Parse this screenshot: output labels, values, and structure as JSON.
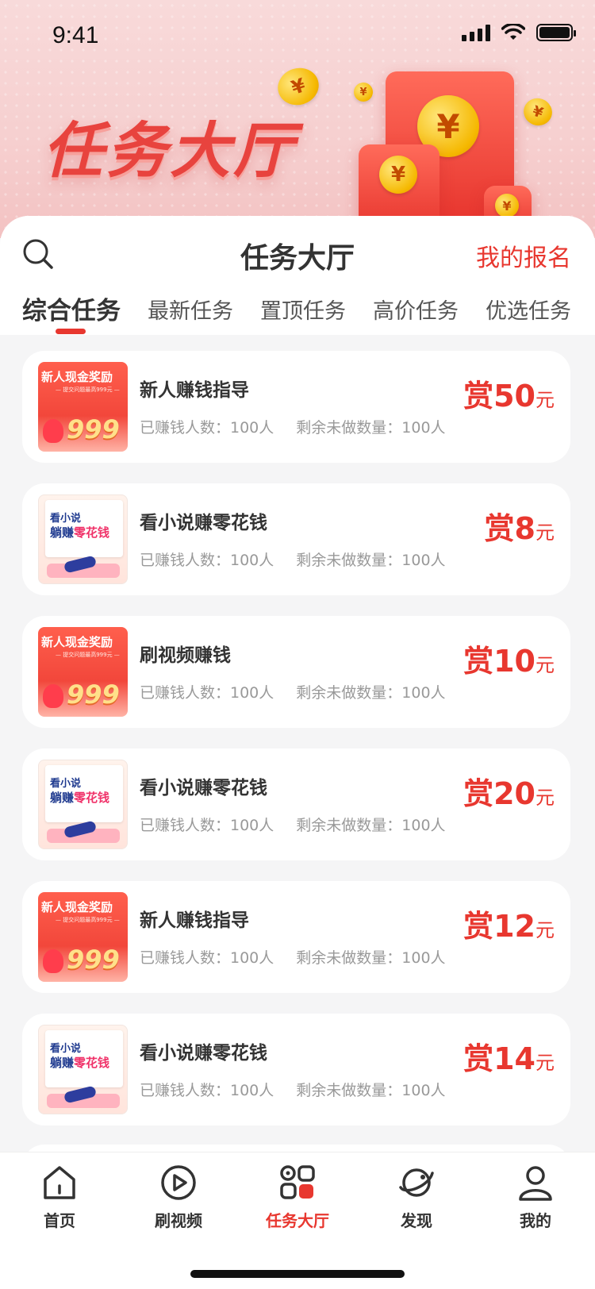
{
  "status_bar": {
    "time": "9:41"
  },
  "banner": {
    "title": "任务大厅"
  },
  "header": {
    "title": "任务大厅",
    "my_signup": "我的报名"
  },
  "tabs": [
    {
      "label": "综合任务",
      "active": true
    },
    {
      "label": "最新任务"
    },
    {
      "label": "置顶任务"
    },
    {
      "label": "高价任务"
    },
    {
      "label": "优选任务"
    }
  ],
  "thumbnails": {
    "cash": {
      "headline": "新人现金奖励",
      "sub": "— 提交问题最高999元 —",
      "amount": "999"
    },
    "novel": {
      "line1": "看小说",
      "line2a": "躺赚",
      "line2b": "零花钱"
    }
  },
  "tasks": [
    {
      "name": "新人赚钱指导",
      "reward_prefix": "赏",
      "reward": "50",
      "unit": "元",
      "earned_label": "已赚钱人数：100人",
      "remaining_label": "剩余未做数量：100人",
      "thumb": "cash"
    },
    {
      "name": "看小说赚零花钱",
      "reward_prefix": "赏",
      "reward": "8",
      "unit": "元",
      "earned_label": "已赚钱人数：100人",
      "remaining_label": "剩余未做数量：100人",
      "thumb": "novel"
    },
    {
      "name": "刷视频赚钱",
      "reward_prefix": "赏",
      "reward": "10",
      "unit": "元",
      "earned_label": "已赚钱人数：100人",
      "remaining_label": "剩余未做数量：100人",
      "thumb": "cash"
    },
    {
      "name": "看小说赚零花钱",
      "reward_prefix": "赏",
      "reward": "20",
      "unit": "元",
      "earned_label": "已赚钱人数：100人",
      "remaining_label": "剩余未做数量：100人",
      "thumb": "novel"
    },
    {
      "name": "新人赚钱指导",
      "reward_prefix": "赏",
      "reward": "12",
      "unit": "元",
      "earned_label": "已赚钱人数：100人",
      "remaining_label": "剩余未做数量：100人",
      "thumb": "cash"
    },
    {
      "name": "看小说赚零花钱",
      "reward_prefix": "赏",
      "reward": "14",
      "unit": "元",
      "earned_label": "已赚钱人数：100人",
      "remaining_label": "剩余未做数量：100人",
      "thumb": "novel"
    }
  ],
  "bottom_nav": [
    {
      "label": "首页",
      "icon": "home-icon"
    },
    {
      "label": "刷视频",
      "icon": "play-icon"
    },
    {
      "label": "任务大厅",
      "icon": "grid-icon",
      "active": true
    },
    {
      "label": "发现",
      "icon": "planet-icon"
    },
    {
      "label": "我的",
      "icon": "user-icon"
    }
  ],
  "colors": {
    "accent": "#e8372f",
    "text": "#333333",
    "muted": "#999999"
  }
}
